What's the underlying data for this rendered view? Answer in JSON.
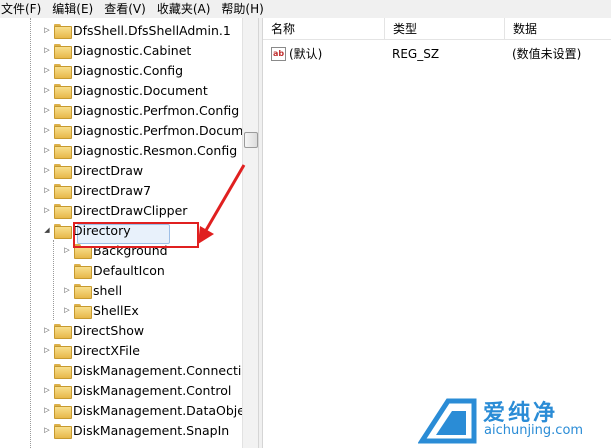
{
  "menu": [
    "文件(F)",
    "编辑(E)",
    "查看(V)",
    "收藏夹(A)",
    "帮助(H)"
  ],
  "tree": {
    "items": [
      {
        "label": "DfsShell.DfsShellAdmin.1",
        "expander": "▷"
      },
      {
        "label": "Diagnostic.Cabinet",
        "expander": "▷"
      },
      {
        "label": "Diagnostic.Config",
        "expander": "▷"
      },
      {
        "label": "Diagnostic.Document",
        "expander": "▷"
      },
      {
        "label": "Diagnostic.Perfmon.Config",
        "expander": "▷"
      },
      {
        "label": "Diagnostic.Perfmon.Docume",
        "expander": "▷"
      },
      {
        "label": "Diagnostic.Resmon.Config",
        "expander": "▷"
      },
      {
        "label": "DirectDraw",
        "expander": "▷"
      },
      {
        "label": "DirectDraw7",
        "expander": "▷"
      },
      {
        "label": "DirectDrawClipper",
        "expander": "▷"
      },
      {
        "label": "Directory",
        "expander": "◢"
      },
      {
        "label": "Background",
        "expander": "▷"
      },
      {
        "label": "DefaultIcon",
        "expander": ""
      },
      {
        "label": "shell",
        "expander": "▷"
      },
      {
        "label": "ShellEx",
        "expander": "▷"
      },
      {
        "label": "DirectShow",
        "expander": "▷"
      },
      {
        "label": "DirectXFile",
        "expander": "▷"
      },
      {
        "label": "DiskManagement.Connectio",
        "expander": ""
      },
      {
        "label": "DiskManagement.Control",
        "expander": "▷"
      },
      {
        "label": "DiskManagement.DataObjec",
        "expander": "▷"
      },
      {
        "label": "DiskManagement.SnapIn",
        "expander": "▷"
      }
    ],
    "selected": "Background"
  },
  "list": {
    "columns": [
      "名称",
      "类型",
      "数据"
    ],
    "rows": [
      {
        "icon": "ab",
        "name": "(默认)",
        "type": "REG_SZ",
        "data": "(数值未设置)"
      }
    ]
  },
  "watermark": {
    "title": "爱纯净",
    "url": "aichunjing.com"
  },
  "colors": {
    "highlight_border": "#e02020",
    "watermark": "#2a8cd6"
  }
}
